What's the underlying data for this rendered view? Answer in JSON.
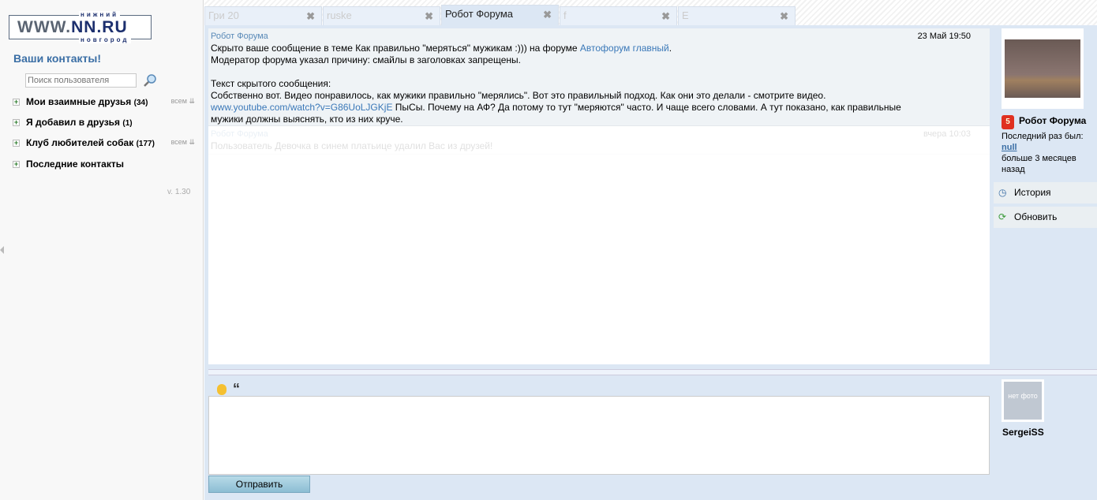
{
  "logo": {
    "top": "нижний",
    "main_a": "WWW.",
    "main_b": "NN.RU",
    "bottom": "новгород"
  },
  "sidebar": {
    "title": "Ваши контакты!",
    "search_placeholder": "Поиск пользователя",
    "groups": [
      {
        "label": "Мои взаимные друзья",
        "count": "(34)",
        "filter": "всем ⇊"
      },
      {
        "label": "Я добавил в друзья",
        "count": "(1)",
        "filter": ""
      },
      {
        "label": "Клуб любителей собак",
        "count": "(177)",
        "filter": "всем ⇊"
      },
      {
        "label": "Последние контакты",
        "count": "",
        "filter": ""
      }
    ],
    "version": "v. 1.30"
  },
  "tabs": [
    {
      "label": "Гри 20"
    },
    {
      "label": "ruske"
    },
    {
      "label": "Робот Форума"
    },
    {
      "label": "f"
    },
    {
      "label": "E"
    }
  ],
  "messages": [
    {
      "from": "Робот Форума",
      "time": "23 Май 19:50",
      "line1": "Скрыто ваше сообщение в теме Как правильно \"меряться\" мужикам :))) на форуме ",
      "link1": "Автофорум главный",
      "line1_end": ".",
      "line2": "Модератор форума указал причину: смайлы в заголовках запрещены.",
      "line3": "Текст скрытого сообщения:",
      "line4": "Собственно вот. Видео понравилось, как мужики правильно \"мерялись\". Вот это правильный подход. Как они это делали - смотрите видео.",
      "link2": "www.youtube.com/watch?v=G86UoLJGKjE",
      "line5": " ПыСы. Почему на АФ? Да потому то тут \"меряются\" часто. И чаще всего словами. А тут показано, как правильные мужики должны выяснять, кто из них круче."
    },
    {
      "from": "Робот Форума",
      "time": "вчера 10:03",
      "text": "Пользователь Девочка в синем платьице удалил Вас из друзей!"
    }
  ],
  "profile": {
    "name": "Робот Форума",
    "badge": "5",
    "last_seen_label": "Последний раз был:",
    "last_seen_value": "null",
    "last_seen_ago": "больше 3 месяцев назад",
    "history": "История",
    "refresh": "Обновить"
  },
  "composer": {
    "send": "Отправить",
    "no_photo": "нет фото",
    "user": "SergeiSS"
  }
}
